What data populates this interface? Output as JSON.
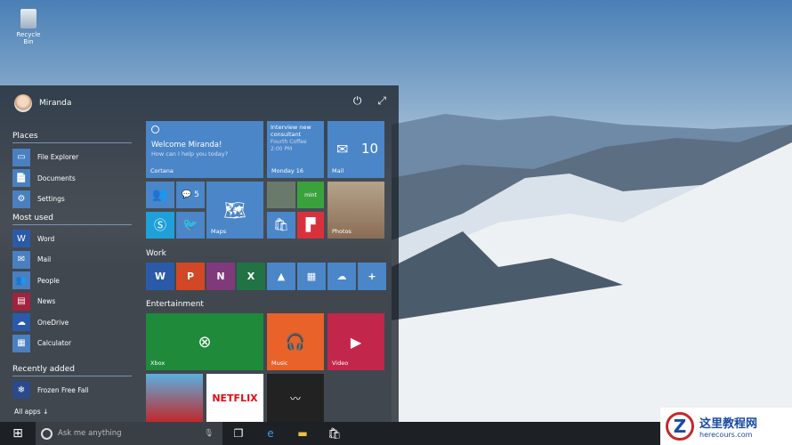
{
  "desktop": {
    "recycle_bin": "Recycle Bin"
  },
  "start": {
    "user": "Miranda",
    "sections": [
      {
        "title": "Places",
        "items": [
          {
            "label": "File Explorer",
            "icon": "folder-icon",
            "color": "#4a7fc0"
          },
          {
            "label": "Documents",
            "icon": "document-icon",
            "color": "#4a7fc0"
          },
          {
            "label": "Settings",
            "icon": "gear-icon",
            "color": "#4a7fc0"
          }
        ]
      },
      {
        "title": "Most used",
        "items": [
          {
            "label": "Word",
            "icon": "word-icon",
            "color": "#2b5ba8"
          },
          {
            "label": "Mail",
            "icon": "mail-icon",
            "color": "#4a7fc0"
          },
          {
            "label": "People",
            "icon": "people-icon",
            "color": "#4a7fc0"
          },
          {
            "label": "News",
            "icon": "news-icon",
            "color": "#a0233f"
          },
          {
            "label": "OneDrive",
            "icon": "cloud-icon",
            "color": "#2b5ba8"
          },
          {
            "label": "Calculator",
            "icon": "calculator-icon",
            "color": "#4a7fc0"
          }
        ]
      },
      {
        "title": "Recently added",
        "items": [
          {
            "label": "Frozen Free Fall",
            "icon": "game-icon",
            "color": "#2b4a8a"
          }
        ]
      }
    ],
    "all_apps": "All apps ↓"
  },
  "tiles": {
    "cortana": {
      "title": "Welcome Miranda!",
      "subtitle": "How can I help you today?",
      "label": "Cortana"
    },
    "calendar": {
      "line1": "Interview new consultant",
      "line2": "Fourth Coffee",
      "line3": "2:00 PM",
      "label": "Monday 16"
    },
    "mail": {
      "count": "10",
      "label": "Mail"
    },
    "messaging_count": "5",
    "maps": "Maps",
    "photos": "Photos",
    "mint": "mint",
    "work_title": "Work",
    "entertainment_title": "Entertainment",
    "xbox": "Xbox",
    "music": "Music",
    "video": "Video",
    "netflix": "NETFLIX"
  },
  "taskbar": {
    "search_placeholder": "Ask me anything"
  },
  "watermark": {
    "name": "这里教程网",
    "url": "herecours.com"
  }
}
